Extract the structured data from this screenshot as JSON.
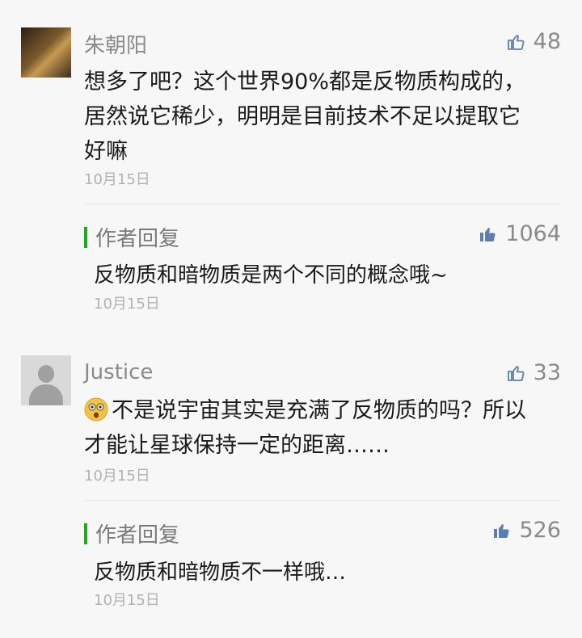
{
  "comments": [
    {
      "nickname": "朱朝阳",
      "likes": "48",
      "lines": [
        "想多了吧？这个世界90%都是反物质构成的，",
        "居然说它稀少，明明是目前技术不足以提取它",
        "好嘛"
      ],
      "date": "10月15日",
      "reply": {
        "label": "作者回复",
        "likes": "1064",
        "text": "反物质和暗物质是两个不同的概念哦~",
        "date": "10月15日"
      }
    },
    {
      "nickname": "Justice",
      "likes": "33",
      "lines": [
        "不是说宇宙其实是充满了反物质的吗？所以",
        "才能让星球保持一定的距离……"
      ],
      "date": "10月15日",
      "reply": {
        "label": "作者回复",
        "likes": "526",
        "text": "反物质和暗物质不一样哦…",
        "date": "10月15日"
      }
    }
  ],
  "icons": {
    "like_outline": "thumbs-up-outline-icon",
    "like_filled": "thumbs-up-filled-icon",
    "emoji": "surprised-face-emoji-icon"
  },
  "colors": {
    "reply_accent": "#1aad19",
    "like_icon": "#5b7db1"
  }
}
